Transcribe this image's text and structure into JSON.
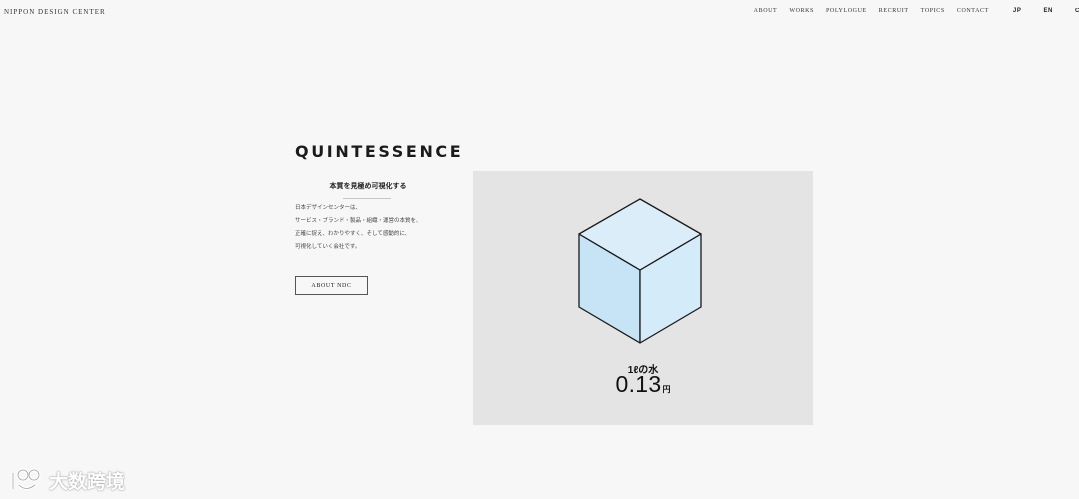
{
  "header": {
    "logo": "NIPPON DESIGN CENTER",
    "nav": [
      "ABOUT",
      "WORKS",
      "POLYLOGUE",
      "RECRUIT",
      "TOPICS",
      "CONTACT"
    ],
    "lang": [
      "JP",
      "EN"
    ],
    "lang_extra": "C"
  },
  "main": {
    "heading": "QUINTESSENCE",
    "subheading": "本質を見極め可視化する",
    "description": [
      "日本デザインセンターは、",
      "サービス・ブランド・製品・組織・運営の本質を、",
      "正確に捉え、わかりやすく、そして感動的に、",
      "可視化していく会社です。"
    ],
    "about_button": "ABOUT NDC"
  },
  "visual": {
    "caption": "1ℓの水",
    "price_value": "0.13",
    "price_unit": "円",
    "cube_colors": {
      "left": "#c7e3f6",
      "right": "#d4ebf9",
      "top": "#dcedfa",
      "stroke": "#1a1a1a"
    },
    "panel_color": "#e4e4e5"
  },
  "watermark": {
    "icon": "ibjd-logo-icon",
    "text": "大数跨境"
  }
}
